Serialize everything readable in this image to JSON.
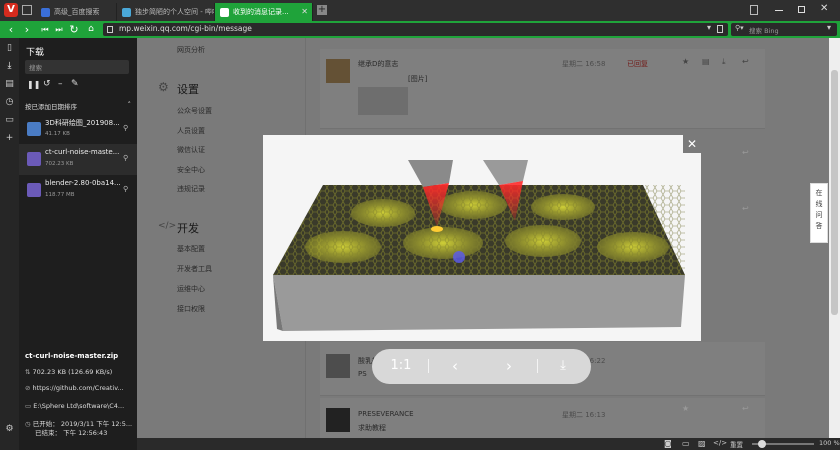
{
  "browser": {
    "tabs": [
      {
        "label": "高级_百度搜索"
      },
      {
        "label": "独步简陋的个人空间 - 哔哩哔哩"
      },
      {
        "label": "收到的消息记录..."
      }
    ],
    "url": "mp.weixin.qq.com/cgi-bin/message",
    "search_placeholder": "搜索 Bing"
  },
  "downloads": {
    "title": "下载",
    "search_placeholder": "搜索",
    "sort_label": "按已添加日期排序",
    "items": [
      {
        "name": "3D科研绘图_201908...",
        "size": "41.17 KB"
      },
      {
        "name": "ct-curl-noise-maste...",
        "size": "702.23 KB"
      },
      {
        "name": "blender-2.80-0ba14...",
        "size": "118.77 MB"
      }
    ],
    "detail": {
      "filename": "ct-curl-noise-master.zip",
      "size_speed": "702.23 KB (126.69 KB/s)",
      "source": "https://github.com/Creativ...",
      "path": "E:\\Sphere Ltd\\software\\C4...",
      "started": "已开始： 2019/3/11 下午 12:5...",
      "finished": "已结束： 下午 12:56:43"
    }
  },
  "sidebar_menu": {
    "top_item": "网页分析",
    "settings_title": "设置",
    "settings_items": [
      "公众号设置",
      "人员设置",
      "微信认证",
      "安全中心",
      "违规记录"
    ],
    "dev_title": "开发",
    "dev_items": [
      "基本配置",
      "开发者工具",
      "运维中心",
      "接口权限"
    ]
  },
  "messages": [
    {
      "name": "继承D的意志",
      "preview": "[图片]",
      "time": "星期二 16:58",
      "status": "已回复"
    },
    {
      "name": "酸乳奶",
      "preview": "PS",
      "time": "星期二 16:22",
      "status": ""
    },
    {
      "name": "PRESEVERANCE",
      "preview": "求助教程",
      "time": "星期二 16:13",
      "status": ""
    }
  ],
  "help_label": "在线问答",
  "viewer": {
    "zoom_label": "1:1"
  },
  "status_bar": {
    "reset_label": "重置",
    "zoom": "100 %"
  },
  "colors": {
    "accent": "#1fa33a",
    "dark": "#1e1e1e",
    "status_red": "#e53935"
  }
}
